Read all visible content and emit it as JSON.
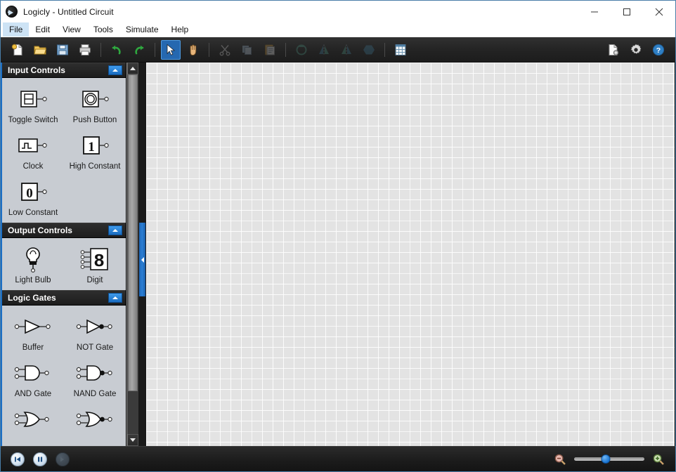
{
  "window": {
    "title": "Logicly - Untitled Circuit",
    "logo_icon": "logicly-logo-icon",
    "controls": [
      {
        "name": "minimize-button",
        "icon": "minimize-icon"
      },
      {
        "name": "maximize-button",
        "icon": "maximize-icon"
      },
      {
        "name": "close-button",
        "icon": "close-icon"
      }
    ]
  },
  "menubar": {
    "items": [
      {
        "label": "File",
        "active": true
      },
      {
        "label": "Edit",
        "active": false
      },
      {
        "label": "View",
        "active": false
      },
      {
        "label": "Tools",
        "active": false
      },
      {
        "label": "Simulate",
        "active": false
      },
      {
        "label": "Help",
        "active": false
      }
    ]
  },
  "toolbar": {
    "groups": [
      [
        {
          "name": "new-button",
          "icon": "new-document-icon",
          "state": "enabled"
        },
        {
          "name": "open-button",
          "icon": "open-folder-icon",
          "state": "enabled"
        },
        {
          "name": "save-button",
          "icon": "floppy-disk-icon",
          "state": "enabled"
        },
        {
          "name": "print-button",
          "icon": "printer-icon",
          "state": "enabled"
        }
      ],
      [
        {
          "name": "undo-button",
          "icon": "undo-arrow-icon",
          "state": "enabled"
        },
        {
          "name": "redo-button",
          "icon": "redo-arrow-icon",
          "state": "enabled"
        }
      ],
      [
        {
          "name": "select-tool-button",
          "icon": "cursor-arrow-icon",
          "state": "selected"
        },
        {
          "name": "pan-tool-button",
          "icon": "hand-icon",
          "state": "enabled"
        }
      ],
      [
        {
          "name": "cut-button",
          "icon": "scissors-icon",
          "state": "disabled"
        },
        {
          "name": "copy-button",
          "icon": "copy-icon",
          "state": "disabled"
        },
        {
          "name": "paste-button",
          "icon": "clipboard-paste-icon",
          "state": "disabled"
        }
      ],
      [
        {
          "name": "rotate-button",
          "icon": "rotate-icon",
          "state": "disabled"
        },
        {
          "name": "flip-horizontal-button",
          "icon": "flip-horizontal-icon",
          "state": "disabled"
        },
        {
          "name": "flip-vertical-button",
          "icon": "flip-vertical-icon",
          "state": "disabled"
        },
        {
          "name": "group-button",
          "icon": "hexagon-icon",
          "state": "disabled"
        }
      ],
      [
        {
          "name": "truth-table-button",
          "icon": "table-grid-icon",
          "state": "enabled"
        }
      ]
    ],
    "right_groups": [
      [
        {
          "name": "document-properties-button",
          "icon": "document-settings-icon",
          "state": "enabled"
        },
        {
          "name": "preferences-button",
          "icon": "gear-icon",
          "state": "enabled"
        },
        {
          "name": "help-button",
          "icon": "question-mark-icon",
          "state": "enabled"
        }
      ]
    ]
  },
  "sidebar": {
    "panels": [
      {
        "title": "Input Controls",
        "toggle_icon": "collapse-arrow-icon",
        "items": [
          {
            "label": "Toggle Switch",
            "icon": "toggle-switch-icon"
          },
          {
            "label": "Push Button",
            "icon": "push-button-icon"
          },
          {
            "label": "Clock",
            "icon": "clock-icon"
          },
          {
            "label": "High Constant",
            "icon": "high-constant-icon",
            "value": "1"
          },
          {
            "label": "Low Constant",
            "icon": "low-constant-icon",
            "value": "0"
          }
        ]
      },
      {
        "title": "Output Controls",
        "toggle_icon": "collapse-arrow-icon",
        "items": [
          {
            "label": "Light Bulb",
            "icon": "light-bulb-icon"
          },
          {
            "label": "Digit",
            "icon": "seven-segment-digit-icon",
            "value": "8"
          }
        ]
      },
      {
        "title": "Logic Gates",
        "toggle_icon": "collapse-arrow-icon",
        "items": [
          {
            "label": "Buffer",
            "icon": "buffer-gate-icon"
          },
          {
            "label": "NOT Gate",
            "icon": "not-gate-icon"
          },
          {
            "label": "AND Gate",
            "icon": "and-gate-icon"
          },
          {
            "label": "NAND Gate",
            "icon": "nand-gate-icon"
          },
          {
            "label": "",
            "icon": "or-gate-icon"
          },
          {
            "label": "",
            "icon": "nor-gate-icon"
          }
        ]
      }
    ],
    "scrollbar": {
      "up_icon": "scroll-up-arrow-icon",
      "down_icon": "scroll-down-arrow-icon"
    },
    "splitter": {
      "icon": "collapse-panel-left-arrow-icon"
    }
  },
  "statusbar": {
    "simulation": [
      {
        "name": "restart-simulation-button",
        "icon": "restart-icon",
        "state": "enabled"
      },
      {
        "name": "pause-simulation-button",
        "icon": "pause-icon",
        "state": "enabled"
      },
      {
        "name": "step-simulation-button",
        "icon": "step-icon",
        "state": "disabled"
      }
    ],
    "zoom": {
      "out_icon": "zoom-out-icon",
      "in_icon": "zoom-in-icon",
      "value_percent": 45
    }
  }
}
